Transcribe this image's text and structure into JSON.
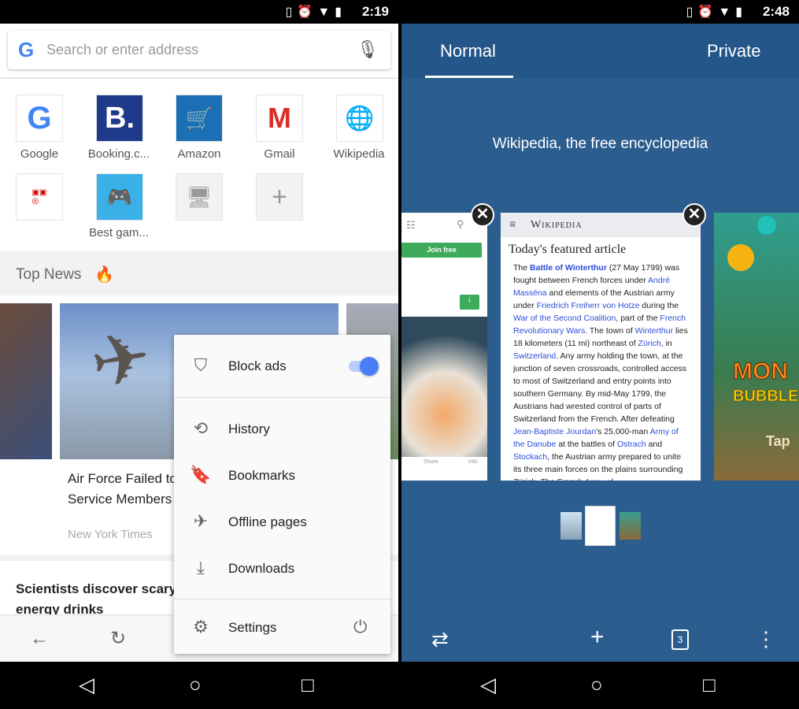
{
  "left": {
    "status": {
      "time": "2:19",
      "icons": [
        "vibrate-icon",
        "alarm-icon",
        "wifi-icon",
        "battery-icon"
      ]
    },
    "search": {
      "placeholder": "Search or enter address"
    },
    "shortcuts": [
      {
        "label": "Google"
      },
      {
        "label": "Booking.c..."
      },
      {
        "label": "Amazon"
      },
      {
        "label": "Gmail"
      },
      {
        "label": "Wikipedia"
      },
      {
        "label": ""
      },
      {
        "label": "Best gam..."
      },
      {
        "label": ""
      },
      {
        "label": ""
      }
    ],
    "top_news": {
      "title": "Top News"
    },
    "news": [
      {
        "title": "Air Force Failed to",
        "title2": "Service Members",
        "source": "New York Times"
      }
    ],
    "news2": {
      "line1": "Scientists discover scary s",
      "line2": "energy drinks"
    },
    "menu": {
      "block_ads": "Block ads",
      "block_ads_on": true,
      "history": "History",
      "bookmarks": "Bookmarks",
      "offline": "Offline pages",
      "downloads": "Downloads",
      "settings": "Settings"
    },
    "accent": "#4a7ef5"
  },
  "right": {
    "status": {
      "time": "2:48"
    },
    "tabs": {
      "normal": "Normal",
      "private": "Private",
      "active": "Normal"
    },
    "page_title": "Wikipedia, the free encyclopedia",
    "left_card": {
      "join": "Join free",
      "share": "Share",
      "info": "Info"
    },
    "wiki": {
      "logo": "Wikipedia",
      "heading": "Today's featured article",
      "parts": [
        [
          "The ",
          0
        ],
        [
          "Battle of Winterthur",
          2
        ],
        [
          " (27 May 1799) was fought between French forces under ",
          0
        ],
        [
          "André Masséna",
          1
        ],
        [
          " and elements of the Austrian army under ",
          0
        ],
        [
          "Friedrich Freiherr von Hotze",
          1
        ],
        [
          " during the ",
          0
        ],
        [
          "War of the Second Coalition",
          1
        ],
        [
          ", part of the ",
          0
        ],
        [
          "French Revolutionary Wars",
          1
        ],
        [
          ". The town of ",
          0
        ],
        [
          "Winterthur",
          1
        ],
        [
          " lies 18 kilometers (11 mi) northeast of ",
          0
        ],
        [
          "Zürich",
          1
        ],
        [
          ", in ",
          0
        ],
        [
          "Switzerland",
          1
        ],
        [
          ". Any army holding the town, at the junction of seven crossroads, controlled access to most of Switzerland and entry points into southern Germany. By mid-May 1799, the Austrians had wrested control of parts of Switzerland from the French. After defeating ",
          0
        ],
        [
          "Jean-Baptiste Jourdan",
          1
        ],
        [
          "'s 25,000-man ",
          0
        ],
        [
          "Army of the Danube",
          1
        ],
        [
          " at the battles of ",
          0
        ],
        [
          "Ostrach",
          1
        ],
        [
          " and ",
          0
        ],
        [
          "Stockach",
          1
        ],
        [
          ", the Austrian army prepared to unite its three main forces on the plains surrounding Zürich. The French ",
          0
        ],
        [
          "Army of",
          1
        ]
      ]
    },
    "game_card": {
      "text1": "MON",
      "text2": "BUBBLE",
      "text3": "Tap"
    },
    "tab_count": "3",
    "bg": "#2c5d8f"
  }
}
